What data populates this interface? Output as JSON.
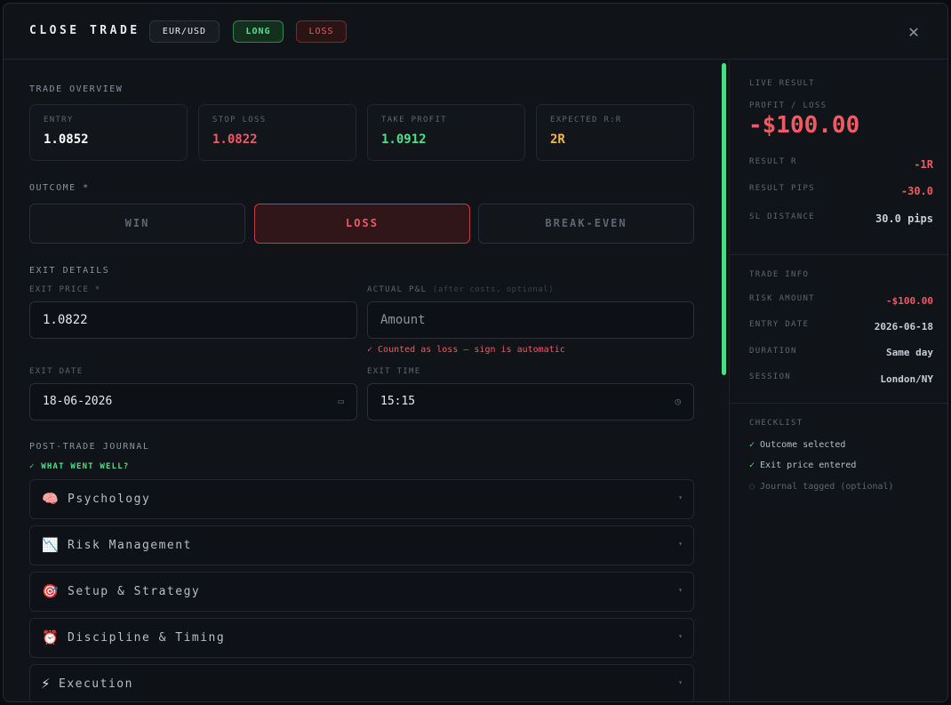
{
  "header": {
    "title": "CLOSE TRADE",
    "pair": "EUR/USD",
    "direction": "LONG",
    "status": "LOSS",
    "close_icon": "close-icon"
  },
  "overview": {
    "label": "TRADE OVERVIEW",
    "cards": [
      {
        "label": "ENTRY",
        "value": "1.0852",
        "color": "#ffffff"
      },
      {
        "label": "STOP LOSS",
        "value": "1.0822",
        "color": "#f05a64"
      },
      {
        "label": "TAKE PROFIT",
        "value": "1.0912",
        "color": "#4fe08a"
      },
      {
        "label": "EXPECTED R:R",
        "value": "2R",
        "color": "#f2b84b"
      }
    ]
  },
  "outcome": {
    "label": "OUTCOME *",
    "options": [
      "WIN",
      "LOSS",
      "BREAK-EVEN"
    ],
    "selected": "LOSS"
  },
  "exit": {
    "label": "EXIT DETAILS",
    "price_label": "EXIT PRICE *",
    "price_value": "1.0822",
    "pnl_label": "ACTUAL P&L",
    "pnl_hint": "(after costs, optional)",
    "pnl_placeholder": "Amount",
    "pnl_note": "✓ Counted as loss — sign is automatic",
    "date_label": "EXIT DATE",
    "date_value": "18-06-2026",
    "time_label": "EXIT TIME",
    "time_value": "15:15"
  },
  "journal": {
    "label": "POST-TRADE JOURNAL",
    "prompt": "✓ WHAT WENT WELL?",
    "sections": [
      {
        "emoji": "🧠",
        "label": "Psychology"
      },
      {
        "emoji": "📉",
        "label": "Risk Management"
      },
      {
        "emoji": "🎯",
        "label": "Setup & Strategy"
      },
      {
        "emoji": "⏰",
        "label": "Discipline & Timing"
      },
      {
        "emoji": "⚡",
        "label": "Execution"
      }
    ]
  },
  "live": {
    "label": "LIVE RESULT",
    "pl_label": "PROFIT / LOSS",
    "pl_value": "-$100.00",
    "rows": [
      {
        "label": "RESULT R",
        "value": "-1R",
        "color": "#f05a64"
      },
      {
        "label": "RESULT PIPS",
        "value": "-30.0",
        "color": "#f05a64"
      },
      {
        "label": "SL DISTANCE",
        "value": "30.0 pips",
        "color": "#c7cdd6"
      }
    ]
  },
  "info": {
    "label": "TRADE INFO",
    "rows": [
      {
        "label": "RISK AMOUNT",
        "value": "-$100.00",
        "color": "#f05a64"
      },
      {
        "label": "ENTRY DATE",
        "value": "2026-06-18",
        "color": "#c7cdd6"
      },
      {
        "label": "DURATION",
        "value": "Same day",
        "color": "#c7cdd6"
      },
      {
        "label": "SESSION",
        "value": "London/NY",
        "color": "#c7cdd6"
      }
    ]
  },
  "checklist": {
    "label": "CHECKLIST",
    "items": [
      {
        "mark": "✓",
        "text": "Outcome selected",
        "done": true
      },
      {
        "mark": "✓",
        "text": "Exit price entered",
        "done": true
      },
      {
        "mark": "○",
        "text": "Journal tagged (optional)",
        "done": false
      }
    ]
  }
}
